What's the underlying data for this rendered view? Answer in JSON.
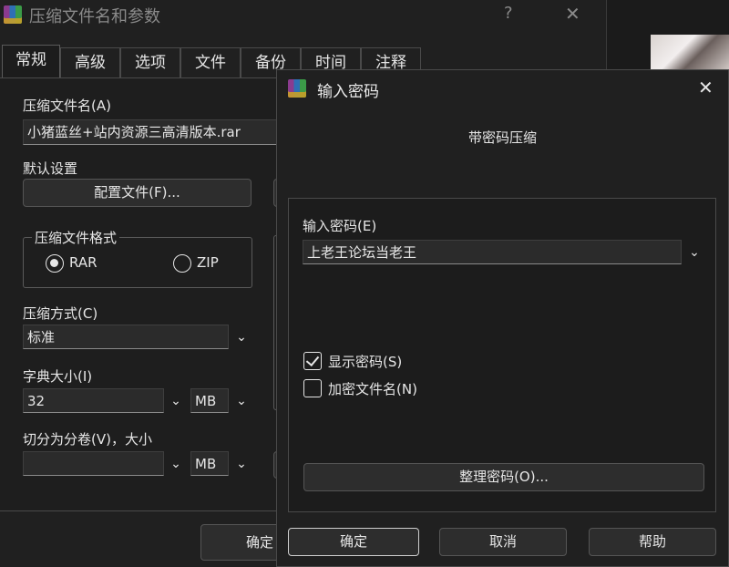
{
  "main_dialog": {
    "title": "压缩文件名和参数",
    "help_glyph": "?",
    "close_glyph": "✕",
    "tabs": [
      {
        "label": "常规"
      },
      {
        "label": "高级"
      },
      {
        "label": "选项"
      },
      {
        "label": "文件"
      },
      {
        "label": "备份"
      },
      {
        "label": "时间"
      },
      {
        "label": "注释"
      }
    ],
    "archive_name_label": "压缩文件名(A)",
    "archive_name_value": "小猪蓝丝+站内资源三高清版本.rar",
    "default_settings_label": "默认设置",
    "profiles_button": "配置文件(F)...",
    "format_group_label": "压缩文件格式",
    "format_rar": "RAR",
    "format_zip": "ZIP",
    "method_label": "压缩方式(C)",
    "method_value": "标准",
    "dictionary_label": "字典大小(I)",
    "dictionary_value": "32",
    "dictionary_unit": "MB",
    "split_label": "切分为分卷(V)，大小",
    "split_value": "",
    "split_unit": "MB",
    "ok_button": "确定"
  },
  "password_dialog": {
    "title": "输入密码",
    "close_glyph": "✕",
    "subtitle": "带密码压缩",
    "password_label": "输入密码(E)",
    "password_value": "上老王论坛当老王",
    "show_password_label": "显示密码(S)",
    "show_password_checked": true,
    "encrypt_names_label": "加密文件名(N)",
    "encrypt_names_checked": false,
    "organize_button": "整理密码(O)...",
    "ok_button": "确定",
    "cancel_button": "取消",
    "help_button": "帮助"
  }
}
